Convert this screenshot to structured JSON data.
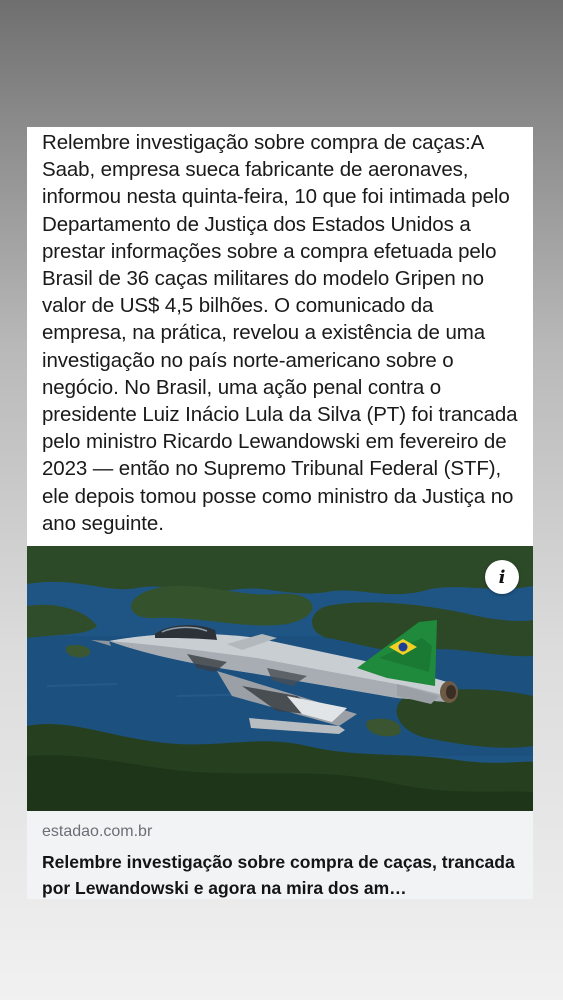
{
  "post": {
    "caption": "Relembre investigação sobre compra de caças:A Saab, empresa sueca fabricante de aeronaves, informou nesta quinta-feira, 10 que foi intimada pelo Departamento de Justiça dos Estados Unidos a prestar informações sobre a compra efetuada pelo Brasil de 36 caças militares do modelo Gripen no valor de US$ 4,5 bilhões. O comunicado da empresa, na prática, revelou a existência de uma investigação no país norte-americano sobre o negócio. No Brasil, uma ação penal contra o presidente Luiz Inácio Lula da Silva (PT) foi trancada pelo ministro Ricardo Lewandowski em fevereiro de 2023 — então no Supremo Tribunal Federal (STF), ele depois tomou posse como ministro da Justiça no ano seguinte."
  },
  "link_preview": {
    "info_icon": "info-icon",
    "info_glyph": "i",
    "domain": "estadao.com.br",
    "headline": "Relembre investigação sobre compra de caças, trancada por Lewandowski e agora na mira dos am…"
  },
  "colors": {
    "card_background": "#ffffff",
    "preview_background": "#f2f3f5",
    "domain_text": "#6b6f75",
    "water": "#1d4f7e",
    "forest": "#2f4a2a",
    "jet_body": "#c8ccd0",
    "flag_green": "#1f8a3b",
    "flag_yellow": "#f2d024",
    "flag_blue": "#1c3f94"
  }
}
